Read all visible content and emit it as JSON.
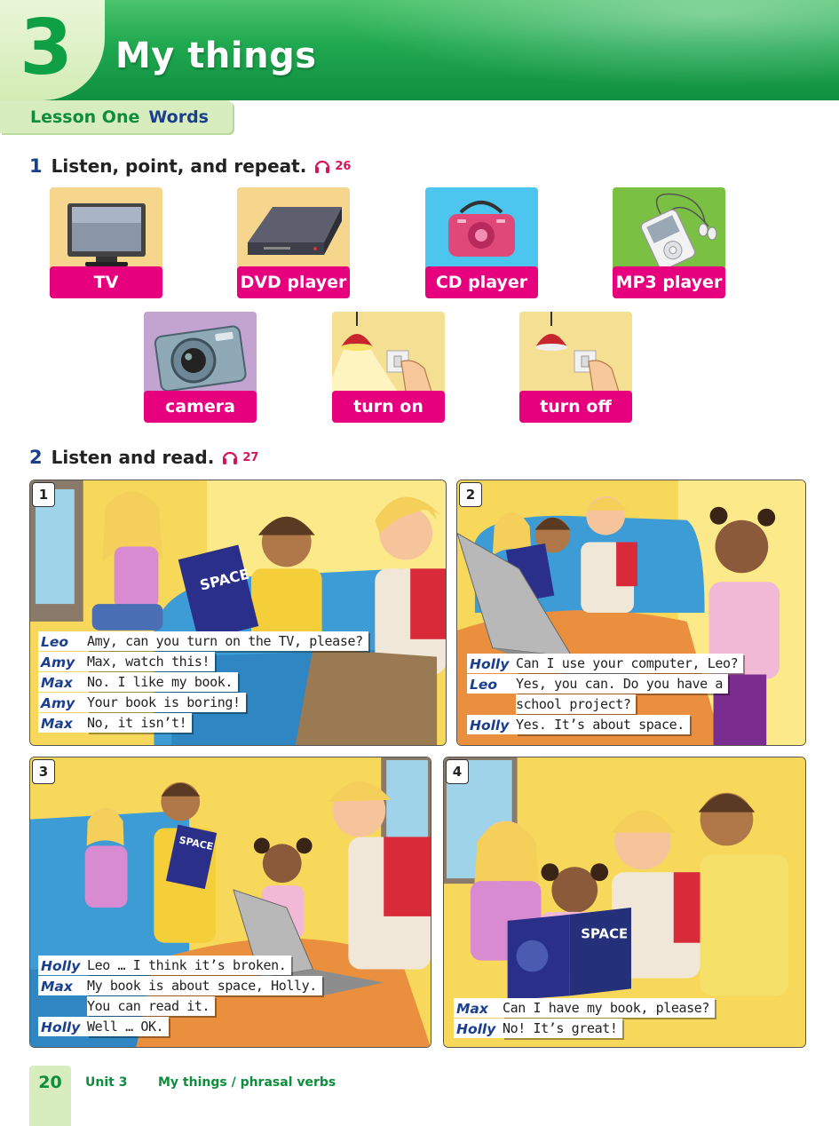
{
  "header": {
    "unit_number": "3",
    "unit_title": "My things",
    "lesson": "Lesson One",
    "lesson_section": "Words"
  },
  "exercise1": {
    "number": "1",
    "instruction": "Listen, point, and repeat.",
    "track": "26",
    "words": [
      "TV",
      "DVD player",
      "CD player",
      "MP3 player",
      "camera",
      "turn on",
      "turn off"
    ]
  },
  "exercise2": {
    "number": "2",
    "instruction": "Listen and read.",
    "track": "27"
  },
  "panels": [
    {
      "number": "1",
      "lines": [
        {
          "speaker": "Leo",
          "text": "Amy, can you turn on the TV, please?"
        },
        {
          "speaker": "Amy",
          "text": "Max, watch this!"
        },
        {
          "speaker": "Max",
          "text": "No. I like my book."
        },
        {
          "speaker": "Amy",
          "text": "Your book is boring!"
        },
        {
          "speaker": "Max",
          "text": "No, it isn’t!"
        }
      ]
    },
    {
      "number": "2",
      "lines": [
        {
          "speaker": "Holly",
          "text": "Can I use your computer, Leo?"
        },
        {
          "speaker": "Leo",
          "text": "Yes, you can. Do you have a"
        },
        {
          "speaker": "",
          "text": "school project?"
        },
        {
          "speaker": "Holly",
          "text": "Yes. It’s about space."
        }
      ]
    },
    {
      "number": "3",
      "lines": [
        {
          "speaker": "Holly",
          "text": "Leo … I think it’s broken."
        },
        {
          "speaker": "Max",
          "text": "My book is about space, Holly."
        },
        {
          "speaker": "",
          "text": "You can read it."
        },
        {
          "speaker": "Holly",
          "text": "Well … OK."
        }
      ]
    },
    {
      "number": "4",
      "lines": [
        {
          "speaker": "Max",
          "text": "Can I have my book, please?"
        },
        {
          "speaker": "Holly",
          "text": "No! It’s great!"
        }
      ]
    }
  ],
  "book_cover_text": "SPACE",
  "footer": {
    "page_number": "20",
    "unit": "Unit 3",
    "topic": "My things / phrasal verbs"
  },
  "colors": {
    "header_green": "#1fa84f",
    "lesson_green": "#0e8d3c",
    "word_label_pink": "#e6007e",
    "speaker_blue": "#1a3f8f",
    "audio_red": "#d4145a"
  }
}
